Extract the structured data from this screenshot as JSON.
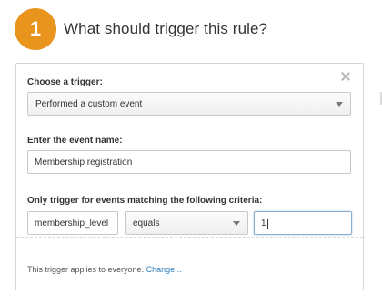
{
  "step": {
    "number": "1",
    "title": "What should trigger this rule?",
    "badge_color": "#e8941d"
  },
  "card": {
    "close_icon": "close-icon",
    "trigger_label": "Choose a trigger:",
    "trigger_selected": "Performed a custom event",
    "event_name_label": "Enter the event name:",
    "event_name_value": "Membership registration",
    "criteria_label": "Only trigger for events matching the following criteria:",
    "criteria": {
      "field": "membership_level",
      "operator": "equals",
      "value": "1"
    },
    "footer_text": "This trigger applies to everyone.",
    "footer_link": "Change..."
  }
}
